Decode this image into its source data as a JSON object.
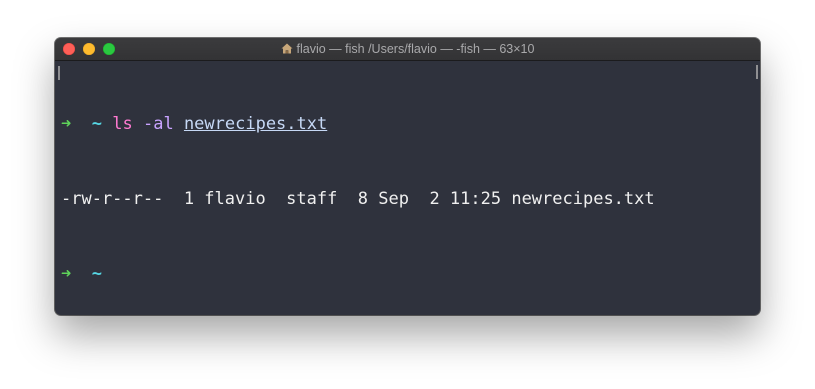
{
  "window": {
    "title": "flavio — fish /Users/flavio — -fish — 63×10",
    "icon": "home-icon"
  },
  "terminal": {
    "lines": [
      {
        "prompt_arrow": "➜",
        "prompt_dir": "~",
        "command": "ls",
        "args": "-al",
        "file": "newrecipes.txt"
      },
      {
        "output": "-rw-r--r--  1 flavio  staff  8 Sep  2 11:25 newrecipes.txt"
      },
      {
        "prompt_arrow": "➜",
        "prompt_dir": "~"
      }
    ]
  },
  "colors": {
    "background": "#2f323d",
    "prompt_arrow": "#5fd35a",
    "prompt_dir": "#56d7e4",
    "command": "#ff7ad1",
    "argument": "#c9a3ff",
    "file": "#c6d8f5"
  }
}
